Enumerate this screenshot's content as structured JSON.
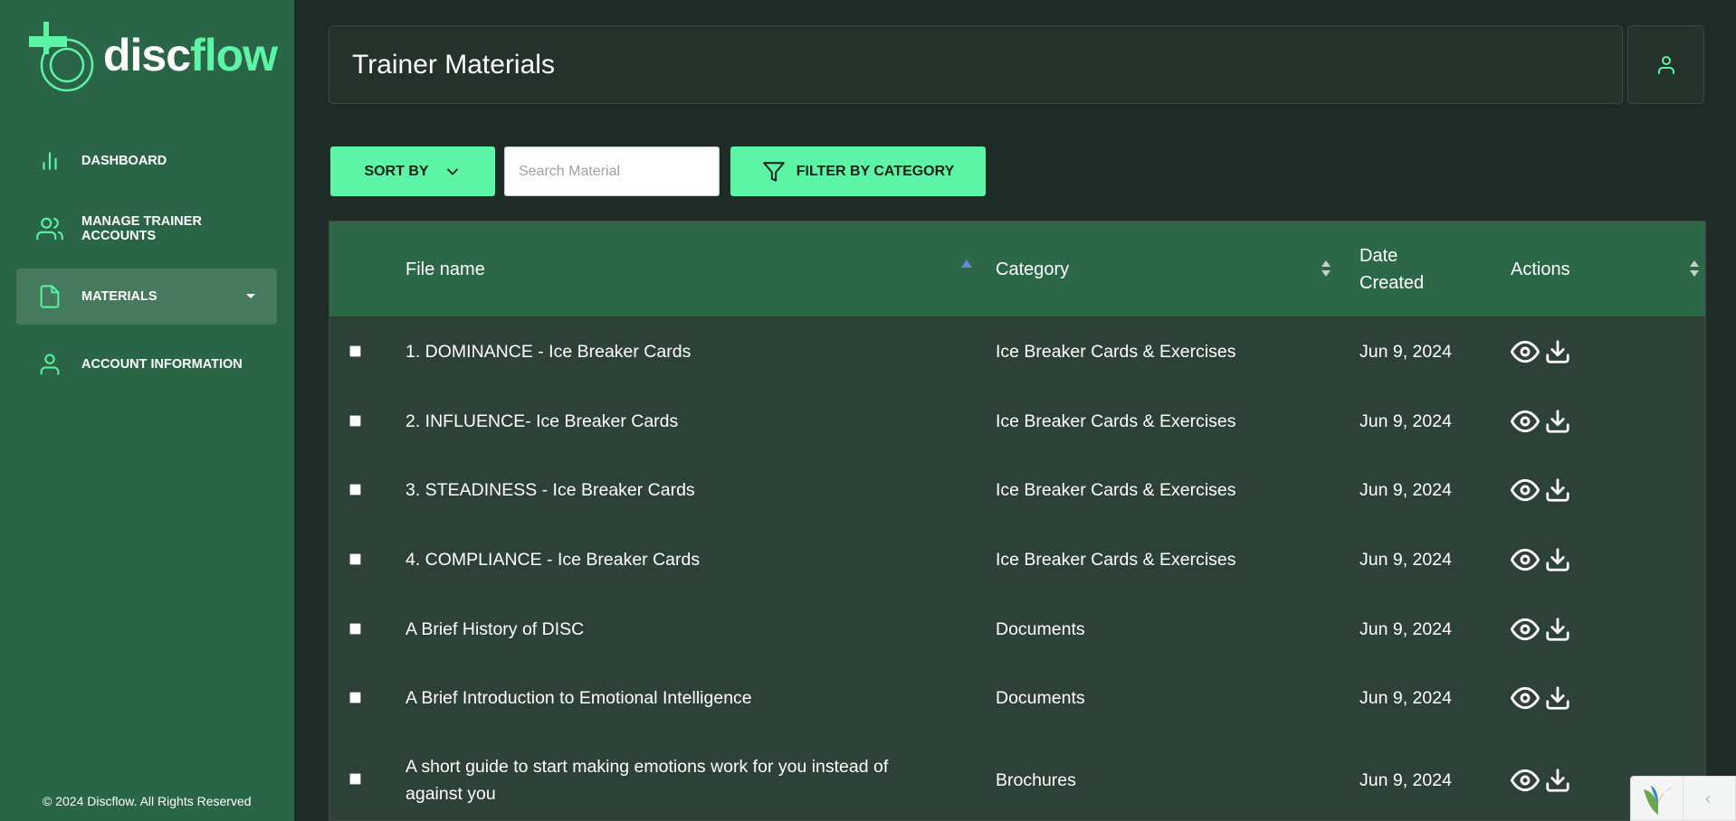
{
  "brand": {
    "logo_word_1": "disc",
    "logo_word_2": "flow",
    "accent": "#5cf5a5",
    "sidebar_bg": "#2a6547"
  },
  "sidebar": {
    "items": [
      {
        "label": "DASHBOARD",
        "icon": "bar-chart-icon",
        "active": false
      },
      {
        "label": "MANAGE TRAINER ACCOUNTS",
        "icon": "users-icon",
        "active": false
      },
      {
        "label": "MATERIALS",
        "icon": "document-icon",
        "active": true
      },
      {
        "label": "ACCOUNT INFORMATION",
        "icon": "user-icon",
        "active": false
      }
    ],
    "footer": "© 2024 Discflow. All Rights Reserved"
  },
  "header": {
    "title": "Trainer Materials",
    "user_icon": "user-icon"
  },
  "toolbar": {
    "sort_label": "SORT BY",
    "search_placeholder": "Search Material",
    "filter_label": "FILTER BY CATEGORY"
  },
  "table": {
    "columns": [
      "File name",
      "Category",
      "Date Created",
      "Actions"
    ],
    "sorted_column": "File name",
    "rows": [
      {
        "file": "1. DOMINANCE - Ice Breaker Cards",
        "category": "Ice Breaker Cards & Exercises",
        "date": "Jun 9, 2024"
      },
      {
        "file": "2. INFLUENCE- Ice Breaker Cards",
        "category": "Ice Breaker Cards & Exercises",
        "date": "Jun 9, 2024"
      },
      {
        "file": "3. STEADINESS - Ice Breaker Cards",
        "category": "Ice Breaker Cards & Exercises",
        "date": "Jun 9, 2024"
      },
      {
        "file": "4. COMPLIANCE - Ice Breaker Cards",
        "category": "Ice Breaker Cards & Exercises",
        "date": "Jun 9, 2024"
      },
      {
        "file": "A Brief History of DISC",
        "category": "Documents",
        "date": "Jun 9, 2024"
      },
      {
        "file": "A Brief Introduction to Emotional Intelligence",
        "category": "Documents",
        "date": "Jun 9, 2024"
      },
      {
        "file": "A short guide to start making emotions work for you instead of against you",
        "category": "Brochures",
        "date": "Jun 9, 2024"
      }
    ],
    "row_actions": [
      "eye-icon",
      "download-icon"
    ]
  }
}
